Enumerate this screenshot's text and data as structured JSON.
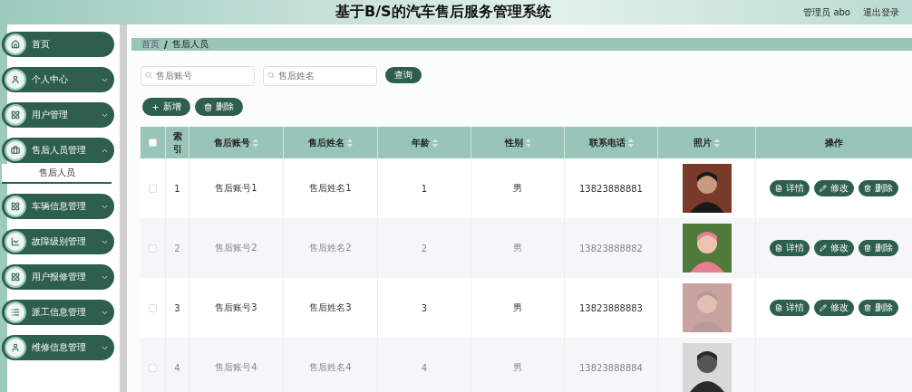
{
  "header": {
    "title": "基于B/S的汽车售后服务管理系统",
    "user": "管理员 abo",
    "logout": "退出登录"
  },
  "sidebar": {
    "items": [
      {
        "label": "首页",
        "kind": "link"
      },
      {
        "label": "个人中心",
        "kind": "group",
        "expanded": false
      },
      {
        "label": "用户管理",
        "kind": "group",
        "expanded": false
      },
      {
        "label": "售后人员管理",
        "kind": "group",
        "expanded": true,
        "children": [
          {
            "label": "售后人员",
            "selected": true
          }
        ]
      },
      {
        "label": "车辆信息管理",
        "kind": "group",
        "expanded": false
      },
      {
        "label": "故障级别管理",
        "kind": "group",
        "expanded": false
      },
      {
        "label": "用户报修管理",
        "kind": "group",
        "expanded": false
      },
      {
        "label": "派工信息管理",
        "kind": "group",
        "expanded": false
      },
      {
        "label": "维修信息管理",
        "kind": "group",
        "expanded": false
      }
    ]
  },
  "breadcrumb": {
    "items": [
      "首页",
      "售后人员"
    ],
    "separator": "/"
  },
  "search": {
    "fields": [
      {
        "placeholder": "售后账号"
      },
      {
        "placeholder": "售后姓名"
      }
    ],
    "button": "查询"
  },
  "toolbar": [
    {
      "kind": "add",
      "label": "新增"
    },
    {
      "kind": "delete",
      "label": "删除"
    }
  ],
  "table": {
    "select_all": {
      "checked": false
    },
    "columns": [
      {
        "label": "索引",
        "sortable": false
      },
      {
        "label": "售后账号",
        "sortable": true
      },
      {
        "label": "售后姓名",
        "sortable": true
      },
      {
        "label": "年龄",
        "sortable": true
      },
      {
        "label": "性别",
        "sortable": true
      },
      {
        "label": "联系电话",
        "sortable": true
      },
      {
        "label": "照片",
        "sortable": true
      },
      {
        "label": "操作",
        "sortable": false
      }
    ],
    "rows": [
      {
        "checked": false,
        "cells": [
          "1",
          "售后账号1",
          "售后姓名1",
          "1",
          "男",
          "13823888881"
        ],
        "actions": [
          {
            "kind": "detail",
            "label": "详情"
          },
          {
            "kind": "edit",
            "label": "修改"
          },
          {
            "kind": "delete",
            "label": "删除"
          }
        ]
      },
      {
        "checked": false,
        "cells": [
          "2",
          "售后账号2",
          "售后姓名2",
          "2",
          "男",
          "13823888882"
        ],
        "actions": [
          {
            "kind": "detail",
            "label": "详情"
          },
          {
            "kind": "edit",
            "label": "修改"
          },
          {
            "kind": "delete",
            "label": "删除"
          }
        ]
      },
      {
        "checked": false,
        "cells": [
          "3",
          "售后账号3",
          "售后姓名3",
          "3",
          "男",
          "13823888883"
        ],
        "actions": [
          {
            "kind": "detail",
            "label": "详情"
          },
          {
            "kind": "edit",
            "label": "修改"
          },
          {
            "kind": "delete",
            "label": "删除"
          }
        ]
      },
      {
        "checked": false,
        "cells": [
          "4",
          "售后账号4",
          "售后姓名4",
          "4",
          "男",
          "13823888884"
        ]
      }
    ]
  }
}
